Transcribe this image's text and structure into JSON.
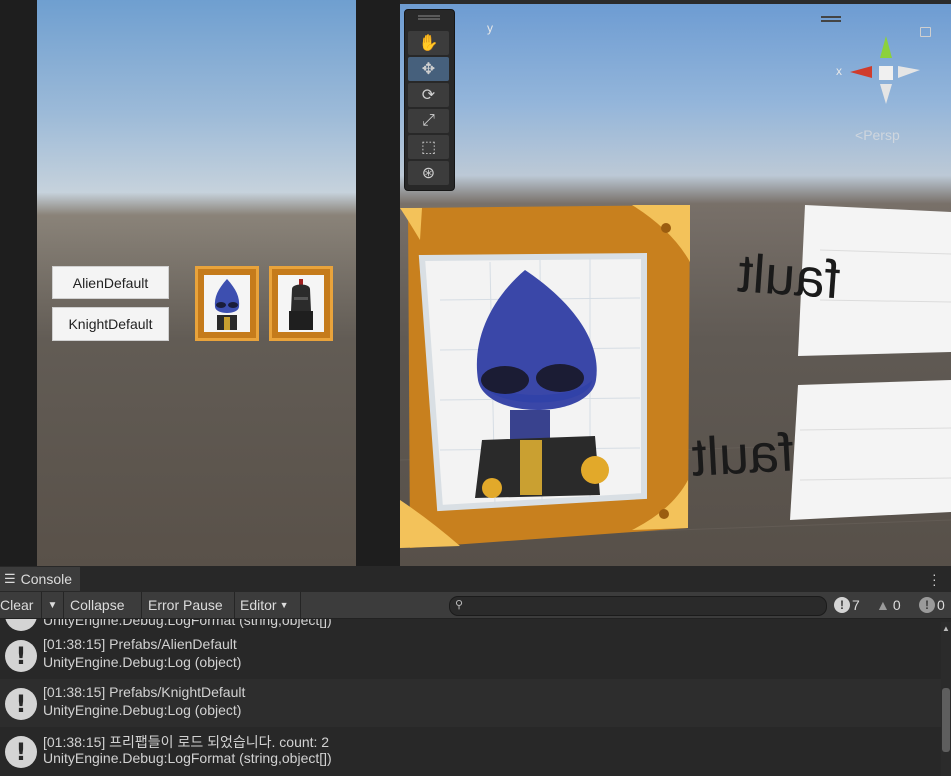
{
  "game": {
    "buttons": [
      "AlienDefault",
      "KnightDefault"
    ]
  },
  "scene": {
    "gizmo": {
      "x_label": "x",
      "y_label": "y",
      "persp_label": "Persp"
    },
    "tools": [
      "hand-icon",
      "move-icon",
      "rotate-icon",
      "scale-icon",
      "rect-icon",
      "transform-icon"
    ],
    "mirrored_text_top": "fault",
    "mirrored_text_bottom": "fault"
  },
  "console": {
    "tab_label": "Console",
    "toolbar": {
      "clear": "Clear",
      "collapse": "Collapse",
      "error_pause": "Error Pause",
      "editor": "Editor"
    },
    "counts": {
      "info": "7",
      "warning": "0",
      "error": "0"
    },
    "partial_top": "UnityEngine.Debug:LogFormat (string,object[])",
    "logs": [
      {
        "line1": "[01:38:15] Prefabs/AlienDefault",
        "line2": "UnityEngine.Debug:Log (object)"
      },
      {
        "line1": "[01:38:15] Prefabs/KnightDefault",
        "line2": "UnityEngine.Debug:Log (object)"
      },
      {
        "line1": "[01:38:15] 프리팹들이 로드 되었습니다. count: 2",
        "line2": "UnityEngine.Debug:LogFormat (string,object[])"
      }
    ]
  }
}
